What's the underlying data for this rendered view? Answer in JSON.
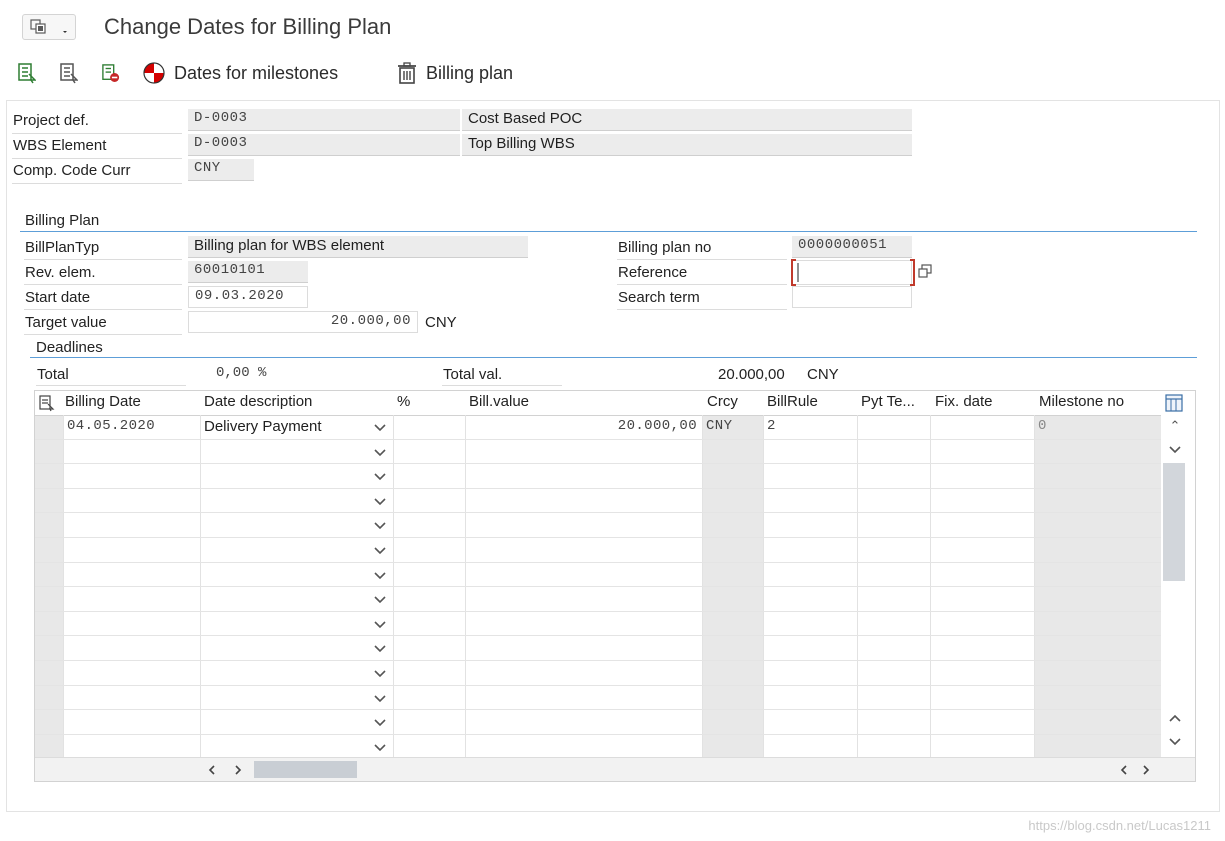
{
  "window": {
    "title": "Change Dates for Billing Plan"
  },
  "toolbar": {
    "dates_for_milestones_label": "Dates for milestones",
    "billing_plan_label": "Billing plan"
  },
  "header": {
    "project_def": {
      "label": "Project def.",
      "value": "D-0003",
      "description": "Cost Based POC"
    },
    "wbs_element": {
      "label": "WBS Element",
      "value": "D-0003",
      "description": "Top Billing WBS"
    },
    "comp_code_curr": {
      "label": "Comp. Code Curr",
      "value": "CNY"
    }
  },
  "billing_plan": {
    "section_title": "Billing Plan",
    "bill_plan_typ": {
      "label": "BillPlanTyp",
      "value": "Billing plan for WBS element"
    },
    "billing_plan_no": {
      "label": "Billing plan no",
      "value": "0000000051"
    },
    "rev_elem": {
      "label": "Rev. elem.",
      "value": "60010101"
    },
    "reference": {
      "label": "Reference",
      "value": ""
    },
    "start_date": {
      "label": "Start date",
      "value": "09.03.2020"
    },
    "search_term": {
      "label": "Search term",
      "value": ""
    },
    "target_value": {
      "label": "Target value",
      "value": "20.000,00",
      "currency": "CNY"
    }
  },
  "deadlines": {
    "section_title": "Deadlines",
    "total_label": "Total",
    "total_value": "0,00 %",
    "total_val_label": "Total val.",
    "total_val_value": "20.000,00",
    "total_val_currency": "CNY",
    "columns": [
      "Billing Date",
      "Date description",
      "%",
      "Bill.value",
      "Crcy",
      "BillRule",
      "Pyt Te...",
      "Fix. date",
      "Milestone no"
    ],
    "rows": [
      {
        "billing_date": "04.05.2020",
        "date_description": "Delivery Payment",
        "percent": "",
        "bill_value": "20.000,00",
        "crcy": "CNY",
        "bill_rule": "2",
        "pyt_terms": "",
        "fix_date": "",
        "milestone_no": "0"
      }
    ]
  },
  "icons": [
    "menu-icon",
    "select-all-icon",
    "deselect-all-icon",
    "delete-row-icon",
    "milestone-icon",
    "trash-icon",
    "table-settings-icon",
    "dropdown-chevron-icon",
    "scroll-up-icon",
    "scroll-down-icon",
    "scroll-left-icon",
    "scroll-right-icon",
    "value-help-icon"
  ],
  "watermark": "https://blog.csdn.net/Lucas1211",
  "colors": {
    "accent_line": "#5d9ed8",
    "required_red": "#c0392b",
    "milestone_red": "#d40000"
  }
}
